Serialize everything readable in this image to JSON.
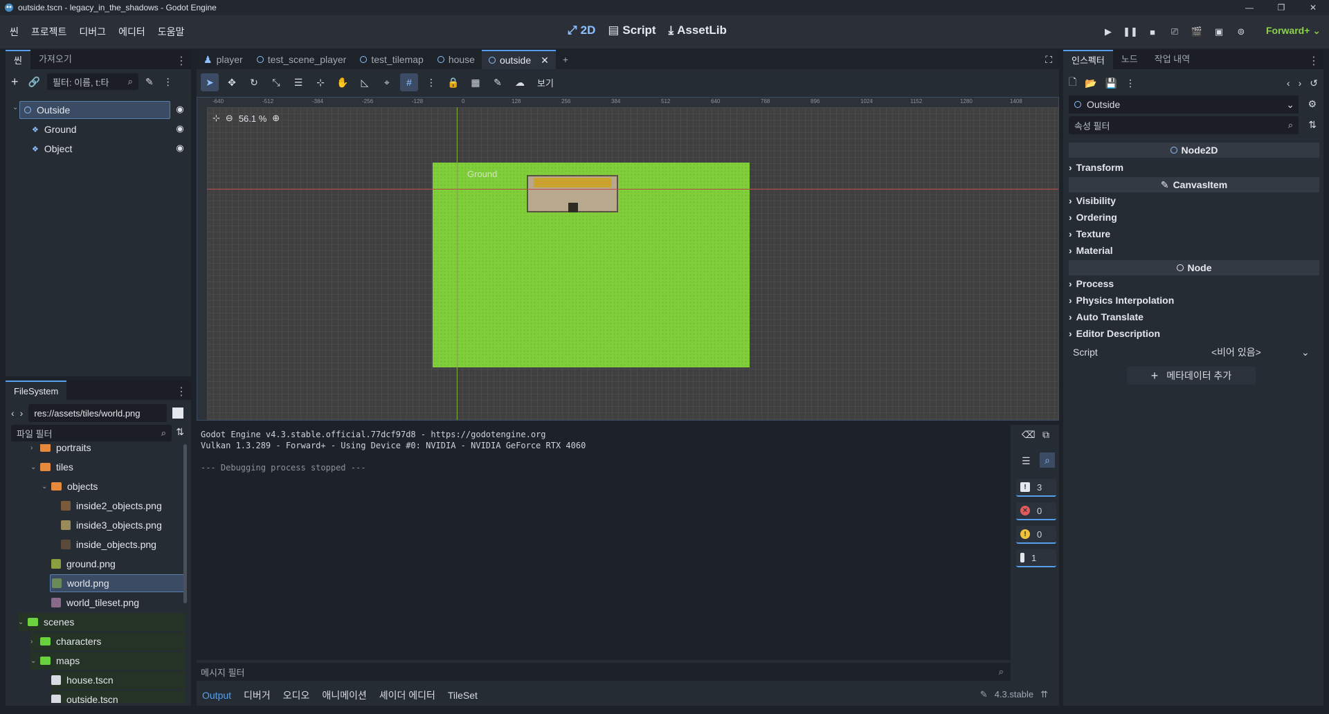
{
  "window": {
    "title": "outside.tscn - legacy_in_the_shadows - Godot Engine",
    "controls": [
      "—",
      "❐",
      "✕"
    ]
  },
  "menu": [
    "씬",
    "프로젝트",
    "디버그",
    "에디터",
    "도움말"
  ],
  "workspaces": [
    {
      "icon": "2d-icon",
      "label": "2D",
      "active": true
    },
    {
      "icon": "script-icon",
      "label": "Script",
      "active": false
    },
    {
      "icon": "assetlib-icon",
      "label": "AssetLib",
      "active": false
    }
  ],
  "renderer": "Forward+",
  "scene_dock": {
    "tabs": [
      "씬",
      "가져오기"
    ],
    "filter_placeholder": "필터: 이름, t:타",
    "tree": [
      {
        "label": "Outside",
        "selected": true
      },
      {
        "label": "Ground",
        "selected": false
      },
      {
        "label": "Object",
        "selected": false
      }
    ]
  },
  "filesystem": {
    "tab": "FileSystem",
    "path": "res://assets/tiles/world.png",
    "filter_placeholder": "파일 필터",
    "items": [
      {
        "label": "portraits",
        "type": "folder-orange",
        "depth": 2
      },
      {
        "label": "tiles",
        "type": "folder-orange",
        "depth": 2
      },
      {
        "label": "objects",
        "type": "folder-orange",
        "depth": 3
      },
      {
        "label": "inside2_objects.png",
        "type": "image",
        "depth": 4
      },
      {
        "label": "inside3_objects.png",
        "type": "image",
        "depth": 4
      },
      {
        "label": "inside_objects.png",
        "type": "image",
        "depth": 4
      },
      {
        "label": "ground.png",
        "type": "image",
        "depth": 3
      },
      {
        "label": "world.png",
        "type": "image",
        "depth": 3,
        "selected": true
      },
      {
        "label": "world_tileset.png",
        "type": "image",
        "depth": 3
      },
      {
        "label": "scenes",
        "type": "folder-green",
        "depth": 1
      },
      {
        "label": "characters",
        "type": "folder-green",
        "depth": 2
      },
      {
        "label": "maps",
        "type": "folder-green",
        "depth": 2
      },
      {
        "label": "house.tscn",
        "type": "scene",
        "depth": 3
      },
      {
        "label": "outside.tscn",
        "type": "scene",
        "depth": 3
      }
    ]
  },
  "editor": {
    "tabs": [
      {
        "label": "player",
        "active": false
      },
      {
        "label": "test_scene_player",
        "active": false
      },
      {
        "label": "test_tilemap",
        "active": false
      },
      {
        "label": "house",
        "active": false
      },
      {
        "label": "outside",
        "active": true
      }
    ],
    "view_menu": "보기",
    "zoom": "56.1 %",
    "viewport_label": "Ground",
    "ruler_ticks": [
      "-640",
      "-512",
      "-384",
      "-256",
      "-128",
      "0",
      "128",
      "256",
      "384",
      "512",
      "640",
      "768",
      "896",
      "1024",
      "1152",
      "1280",
      "1408"
    ]
  },
  "output": {
    "lines": [
      "Godot Engine v4.3.stable.official.77dcf97d8 - https://godotengine.org",
      "Vulkan 1.3.289 - Forward+ - Using Device #0: NVIDIA - NVIDIA GeForce RTX 4060",
      "",
      "--- Debugging process stopped ---"
    ],
    "counts": {
      "messages": "3",
      "errors": "0",
      "warnings": "0",
      "info": "1"
    },
    "filter_placeholder": "메시지 필터",
    "bottom_tabs": [
      "Output",
      "디버거",
      "오디오",
      "애니메이션",
      "셰이더 에디터",
      "TileSet"
    ],
    "version": "4.3.stable"
  },
  "inspector": {
    "tabs": [
      "인스펙터",
      "노드",
      "작업 내역"
    ],
    "node_name": "Outside",
    "filter_placeholder": "속성 필터",
    "sections": [
      {
        "header": "Node2D",
        "categories": [
          "Transform"
        ]
      },
      {
        "header": "CanvasItem",
        "categories": [
          "Visibility",
          "Ordering",
          "Texture",
          "Material"
        ]
      },
      {
        "header": "Node",
        "categories": [
          "Process",
          "Physics Interpolation",
          "Auto Translate",
          "Editor Description"
        ]
      }
    ],
    "script_label": "Script",
    "script_value": "<비어 있음>",
    "add_metadata": "메타데이터 추가"
  }
}
